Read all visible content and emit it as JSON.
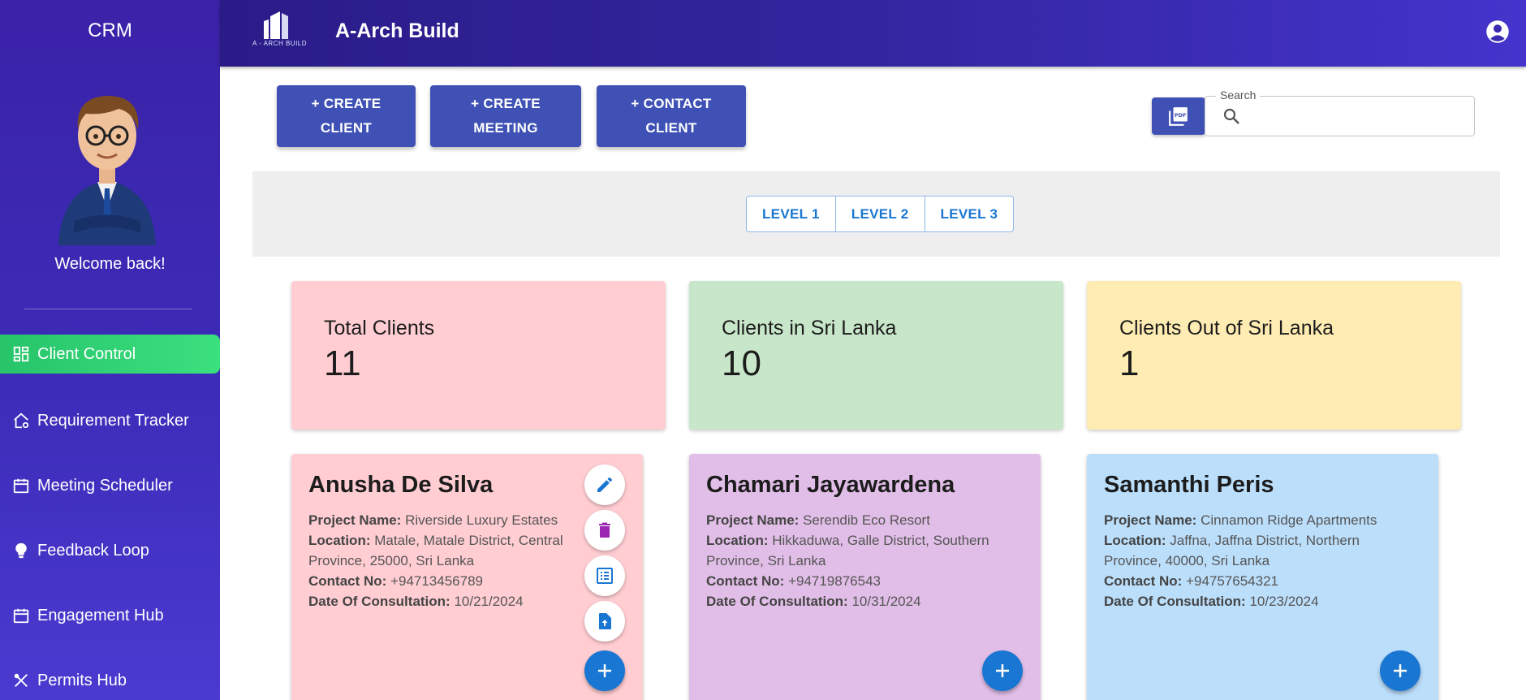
{
  "sidebar": {
    "title": "CRM",
    "welcome": "Welcome back!",
    "items": [
      {
        "label": "Client Control",
        "icon": "dashboard-icon"
      },
      {
        "label": "Requirement Tracker",
        "icon": "home-settings-icon"
      },
      {
        "label": "Meeting Scheduler",
        "icon": "calendar-icon"
      },
      {
        "label": "Feedback Loop",
        "icon": "lightbulb-icon"
      },
      {
        "label": "Engagement Hub",
        "icon": "calendar-icon"
      },
      {
        "label": "Permits Hub",
        "icon": "tools-icon"
      }
    ]
  },
  "header": {
    "logo_text": "A - ARCH BUILD",
    "title": "A-Arch Build"
  },
  "toolbar": {
    "create_client": [
      "+ CREATE",
      "CLIENT"
    ],
    "create_meeting": [
      "+ CREATE",
      "MEETING"
    ],
    "contact_client": [
      "+ CONTACT",
      "CLIENT"
    ]
  },
  "search": {
    "label": "Search",
    "value": "",
    "placeholder": ""
  },
  "levels": [
    "LEVEL 1",
    "LEVEL 2",
    "LEVEL 3"
  ],
  "stats": [
    {
      "label": "Total Clients",
      "value": "11",
      "color": "#ffcdd2"
    },
    {
      "label": "Clients in Sri Lanka",
      "value": "10",
      "color": "#c8e6c9"
    },
    {
      "label": "Clients Out of Sri Lanka",
      "value": "1",
      "color": "#ffecb3"
    }
  ],
  "field_labels": {
    "project": "Project Name:",
    "location": "Location:",
    "contact": "Contact No:",
    "date": "Date Of Consultation:"
  },
  "clients": [
    {
      "name": "Anusha De Silva",
      "project": "Riverside Luxury Estates",
      "location": "Matale, Matale District, Central Province, 25000, Sri Lanka",
      "contact": "+94713456789",
      "date": "10/21/2024",
      "color": "#ffcdd2"
    },
    {
      "name": "Chamari Jayawardena",
      "project": "Serendib Eco Resort",
      "location": "Hikkaduwa, Galle District, Southern Province, Sri Lanka",
      "contact": "+94719876543",
      "date": "10/31/2024",
      "color": "#e1bee7"
    },
    {
      "name": "Samanthi Peris",
      "project": "Cinnamon Ridge Apartments",
      "location": "Jaffna, Jaffna District, Northern Province, 40000, Sri Lanka",
      "contact": "+94757654321",
      "date": "10/23/2024",
      "color": "#bbdefb"
    }
  ],
  "colors": {
    "primary_button": "#3f51b5",
    "fab": "#1976d2",
    "active_nav": "#2ecc71",
    "delete_icon": "#9c27b0"
  }
}
